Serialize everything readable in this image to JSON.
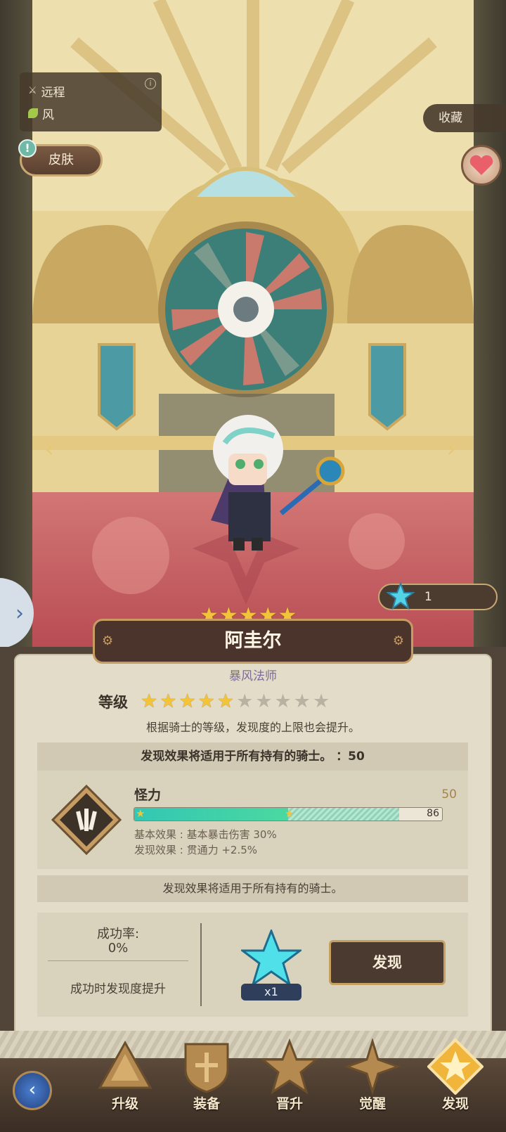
{
  "tags": {
    "attack_type": "远程",
    "element": "风"
  },
  "skin_label": "皮肤",
  "favorite_label": "收藏",
  "star_currency_count": "1",
  "character": {
    "name": "阿圭尔",
    "title": "暴风法师",
    "rarity_stars": 5
  },
  "level": {
    "label": "等级",
    "filled": 5,
    "total": 10,
    "note": "根据骑士的等级，发现度的上限也会提升。"
  },
  "discovery": {
    "header": "发现效果将适用于所有持有的骑士。 ：50",
    "skill_name": "怪力",
    "max_value": "50",
    "progress_value": "86",
    "progress_fraction": 0.86,
    "base_effect": "基本效果 : 基本暴击伤害 30%",
    "discovery_effect": "发现效果 : 贯通力 +2.5%",
    "footer_note": "发现效果将适用于所有持有的骑士。",
    "success_rate_label": "成功率:",
    "success_rate_value": "0%",
    "success_note": "成功时发现度提升",
    "cost_qty": "x1",
    "discover_button": "发现"
  },
  "nav": {
    "items": [
      "升级",
      "装备",
      "晋升",
      "觉醒",
      "发现"
    ],
    "active": "发现"
  },
  "colors": {
    "accent_gold": "#c69c63",
    "panel_bg": "#e3dcc8",
    "teal_bar": "#33c7b4"
  }
}
